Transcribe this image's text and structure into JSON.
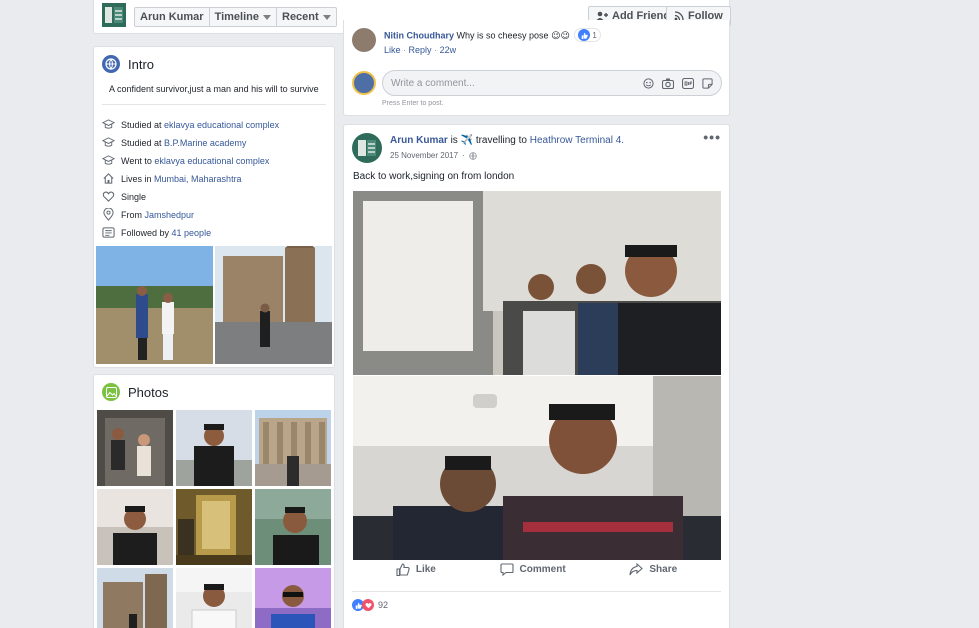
{
  "header": {
    "name": "Arun Kumar",
    "timeline_label": "Timeline",
    "recent_label": "Recent",
    "add_friend_label": "Add Friend",
    "follow_label": "Follow"
  },
  "intro": {
    "title": "Intro",
    "bio": "A confident survivor,just a man and his will to survive",
    "items": [
      {
        "icon": "graduation-cap-icon",
        "prefix": "Studied at ",
        "link": "eklavya educational complex"
      },
      {
        "icon": "graduation-cap-icon",
        "prefix": "Studied at ",
        "link": "B.P.Marine academy"
      },
      {
        "icon": "graduation-cap-icon",
        "prefix": "Went to ",
        "link": "eklavya educational complex"
      },
      {
        "icon": "home-icon",
        "prefix": "Lives in ",
        "link": "Mumbai, Maharashtra"
      },
      {
        "icon": "heart-icon",
        "prefix": "Single",
        "link": ""
      },
      {
        "icon": "location-pin-icon",
        "prefix": "From ",
        "link": "Jamshedpur"
      },
      {
        "icon": "followers-icon",
        "prefix": "Followed by ",
        "link": "41 people"
      }
    ]
  },
  "photos": {
    "title": "Photos"
  },
  "prev_post": {
    "comment_author": "Nitin Choudhary",
    "comment_text": "Why is so cheesy pose",
    "comment_emoji": "😉😉",
    "comment_reaction_count": "1",
    "like_label": "Like",
    "reply_label": "Reply",
    "comment_age": "22w",
    "write_placeholder": "Write a comment...",
    "enter_hint": "Press Enter to post."
  },
  "post": {
    "author": "Arun Kumar",
    "activity_prefix": " is ",
    "activity_text": "travelling to ",
    "place": "Heathrow Terminal 4.",
    "date": "25 November 2017",
    "text": "Back to work,signing on from london",
    "like_label": "Like",
    "comment_label": "Comment",
    "share_label": "Share",
    "reaction_count": "92"
  },
  "colors": {
    "link": "#365899",
    "background": "#e9ebee",
    "like_blue": "#4080ff",
    "love_red": "#f25268"
  }
}
